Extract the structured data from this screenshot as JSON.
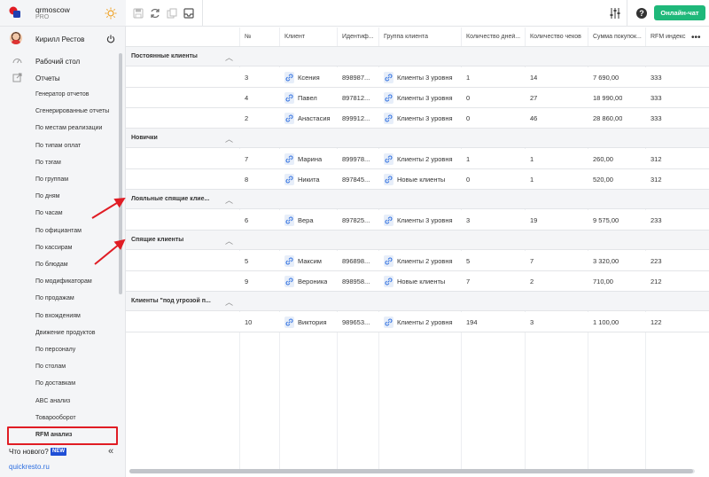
{
  "brand": {
    "name": "qrmoscow",
    "plan": "PRO"
  },
  "user": {
    "name": "Кирилл Рестов"
  },
  "nav": {
    "desktop": "Рабочий стол",
    "reports": "Отчеты",
    "reports_items": [
      "Генератор отчетов",
      "Сгенерированные отчеты",
      "По местам реализации",
      "По типам оплат",
      "По тэгам",
      "По группам",
      "По дням",
      "По часам",
      "По официантам",
      "По кассирам",
      "По блюдам",
      "По модификаторам",
      "По продажам",
      "По вхождениям",
      "Движение продуктов",
      "По персоналу",
      "По столам",
      "По доставкам",
      "ABC анализ",
      "Товарооборот",
      "RFM анализ"
    ],
    "whats_new": "Что нового?",
    "new_badge": "NEW",
    "footer_link": "quickresto.ru"
  },
  "toolbar": {
    "chat_button": "Онлайн-чат"
  },
  "table": {
    "columns": [
      "№",
      "Клиент",
      "Идентиф...",
      "Группа клиента",
      "Количество дней...",
      "Количество чеков",
      "Сумма покупок...",
      "RFM индекс"
    ],
    "groups": [
      {
        "title": "Постоянные клиенты",
        "rows": [
          {
            "num": "3",
            "client": "Ксения",
            "id": "898987...",
            "group": "Клиенты 3 уровня",
            "days": "1",
            "checks": "14",
            "sum": "7 690,00",
            "rfm": "333"
          },
          {
            "num": "4",
            "client": "Павел",
            "id": "897812...",
            "group": "Клиенты 3 уровня",
            "days": "0",
            "checks": "27",
            "sum": "18 990,00",
            "rfm": "333"
          },
          {
            "num": "2",
            "client": "Анастасия",
            "id": "899912...",
            "group": "Клиенты 3 уровня",
            "days": "0",
            "checks": "46",
            "sum": "28 860,00",
            "rfm": "333"
          }
        ]
      },
      {
        "title": "Новички",
        "rows": [
          {
            "num": "7",
            "client": "Марина",
            "id": "899978...",
            "group": "Клиенты 2 уровня",
            "days": "1",
            "checks": "1",
            "sum": "260,00",
            "rfm": "312"
          },
          {
            "num": "8",
            "client": "Никита",
            "id": "897845...",
            "group": "Новые клиенты",
            "days": "0",
            "checks": "1",
            "sum": "520,00",
            "rfm": "312"
          }
        ]
      },
      {
        "title": "Лояльные спящие клие...",
        "rows": [
          {
            "num": "6",
            "client": "Вера",
            "id": "897825...",
            "group": "Клиенты 3 уровня",
            "days": "3",
            "checks": "19",
            "sum": "9 575,00",
            "rfm": "233"
          }
        ]
      },
      {
        "title": "Спящие клиенты",
        "rows": [
          {
            "num": "5",
            "client": "Максим",
            "id": "896898...",
            "group": "Клиенты 2 уровня",
            "days": "5",
            "checks": "7",
            "sum": "3 320,00",
            "rfm": "223"
          },
          {
            "num": "9",
            "client": "Вероника",
            "id": "898958...",
            "group": "Новые клиенты",
            "days": "7",
            "checks": "2",
            "sum": "710,00",
            "rfm": "212"
          }
        ]
      },
      {
        "title": "Клиенты \"под угрозой п...",
        "rows": [
          {
            "num": "10",
            "client": "Виктория",
            "id": "989653...",
            "group": "Клиенты 2 уровня",
            "days": "194",
            "checks": "3",
            "sum": "1 100,00",
            "rfm": "122"
          }
        ]
      }
    ]
  },
  "colors": {
    "accent_green": "#1fb87a",
    "highlight_red": "#e01c24",
    "link_blue": "#2d6ee0"
  }
}
